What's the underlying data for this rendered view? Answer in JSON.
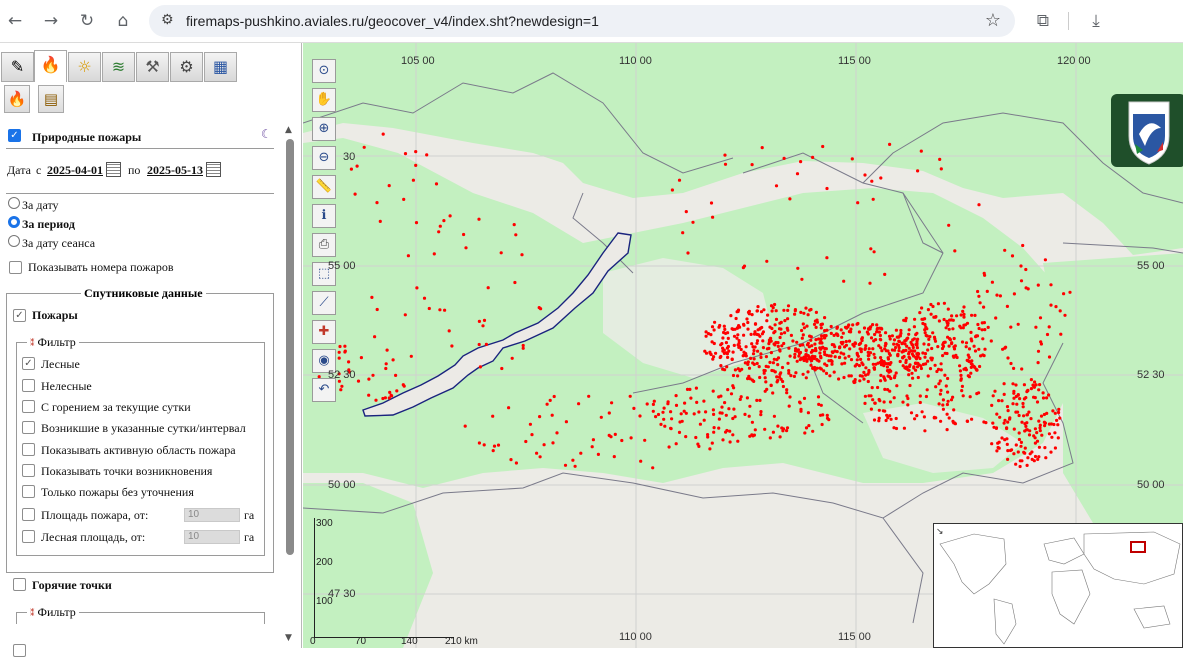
{
  "browser": {
    "url": "firemaps-pushkino.aviales.ru/geocover_v4/index.sht?newdesign=1"
  },
  "panel": {
    "title": "Природные пожары",
    "date_label": "Дата",
    "date_from_label": "с",
    "date_from": "2025-04-01",
    "date_to_label": "по",
    "date_to": "2025-05-13",
    "radio_by_date": "За дату",
    "radio_by_period": "За период",
    "radio_by_session": "За дату сеанса",
    "show_numbers": "Показывать номера пожаров",
    "satellite_legend": "Спутниковые данные",
    "fires_label": "Пожары",
    "filter_legend": "Фильтр",
    "filters": [
      {
        "label": "Лесные",
        "checked": true
      },
      {
        "label": "Нелесные",
        "checked": false
      },
      {
        "label": "С горением за текущие сутки",
        "checked": false
      },
      {
        "label": "Возникшие в указанные сутки/интервал",
        "checked": false
      },
      {
        "label": "Показывать активную область пожара",
        "checked": false
      },
      {
        "label": "Показывать точки возникновения",
        "checked": false
      },
      {
        "label": "Только пожары без уточнения",
        "checked": false
      }
    ],
    "area_label": "Площадь пожара, от:",
    "area_value": "10",
    "area_unit": "га",
    "forest_area_label": "Лесная площадь, от:",
    "forest_area_value": "10",
    "forest_area_unit": "га",
    "hotspots_label": "Горячие точки",
    "hotspots_filter": "Фильтр"
  },
  "map": {
    "lon_labels_top": [
      "105 00",
      "110 00",
      "115 00",
      "120 00"
    ],
    "lon_labels_bottom": [
      "110 00",
      "115 00"
    ],
    "lat_labels": [
      "55 00",
      "52 30",
      "50 00",
      "47 30"
    ],
    "lat_labels_right": [
      "55 00",
      "52 30",
      "50 00"
    ],
    "lat_partial": "30",
    "scale_y": [
      "300",
      "200",
      "100"
    ],
    "scale_x": [
      "0",
      "70",
      "140",
      "210 km"
    ],
    "colors": {
      "forest": "#c3f0c0",
      "land": "#ecebe6",
      "lake": "#eceae6",
      "fire": "#ff0000"
    }
  }
}
